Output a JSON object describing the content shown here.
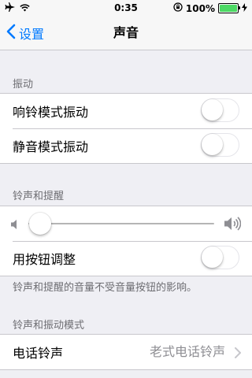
{
  "status_bar": {
    "time": "0:35",
    "battery_percent": "100%",
    "battery_level": 1.0
  },
  "nav": {
    "back_label": "设置",
    "title": "声音"
  },
  "vibration": {
    "header": "振动",
    "items": [
      {
        "label": "响铃模式振动",
        "on": false
      },
      {
        "label": "静音模式振动",
        "on": false
      }
    ]
  },
  "ringer": {
    "header": "铃声和提醒",
    "volume_level": 0.0,
    "button_adjust": {
      "label": "用按钮调整",
      "on": false
    },
    "footnote": "铃声和提醒的音量不受音量按钮的影响。"
  },
  "patterns": {
    "header": "铃声和振动模式",
    "ringtone": {
      "label": "电话铃声",
      "value": "老式电话铃声"
    }
  }
}
